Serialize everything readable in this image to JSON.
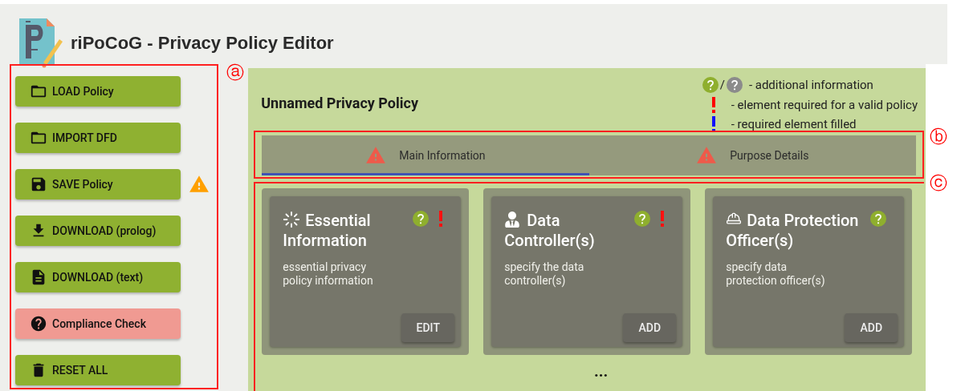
{
  "app": {
    "title": "riPoCoG - Privacy Policy Editor"
  },
  "sidebar": {
    "annotation": "ⓐ",
    "buttons": [
      {
        "label": "LOAD Policy",
        "kind": "folder",
        "color": "#8fb131",
        "warning": false
      },
      {
        "label": "IMPORT DFD",
        "kind": "folder",
        "color": "#8fb131",
        "warning": false
      },
      {
        "label": "SAVE Policy",
        "kind": "save",
        "color": "#8fb131",
        "warning": true
      },
      {
        "label": "DOWNLOAD (prolog)",
        "kind": "download",
        "color": "#8fb131",
        "warning": false
      },
      {
        "label": "DOWNLOAD (text)",
        "kind": "document",
        "color": "#8fb131",
        "warning": false
      },
      {
        "label": "Compliance Check",
        "kind": "help",
        "color": "#f09a92",
        "warning": false
      },
      {
        "label": "RESET ALL",
        "kind": "trash",
        "color": "#8fb131",
        "warning": false
      }
    ]
  },
  "policy": {
    "title": "Unnamed Privacy Policy"
  },
  "legend": [
    {
      "kind": "help",
      "separator": "/",
      "text": "- additional information"
    },
    {
      "kind": "required",
      "text": "- element required for a valid policy"
    },
    {
      "kind": "filled",
      "text": "- required element filled"
    }
  ],
  "tabs": {
    "annotation": "ⓑ",
    "items": [
      {
        "label": "Main Information",
        "selected": true,
        "warning": true
      },
      {
        "label": "Purpose Details",
        "selected": false,
        "warning": true
      }
    ]
  },
  "cards": {
    "annotation": "ⓒ",
    "more": "...",
    "items": [
      {
        "title": "Essential Information",
        "kind": "sparkle",
        "description": "essential privacy policy information",
        "required": true,
        "action": "EDIT"
      },
      {
        "title": "Data Controller(s)",
        "kind": "person",
        "description": "specify the data controller(s)",
        "required": true,
        "action": "ADD"
      },
      {
        "title": "Data Protection Officer(s)",
        "kind": "hat",
        "description": "specify data protection officer(s)",
        "required": false,
        "action": "ADD"
      }
    ]
  }
}
